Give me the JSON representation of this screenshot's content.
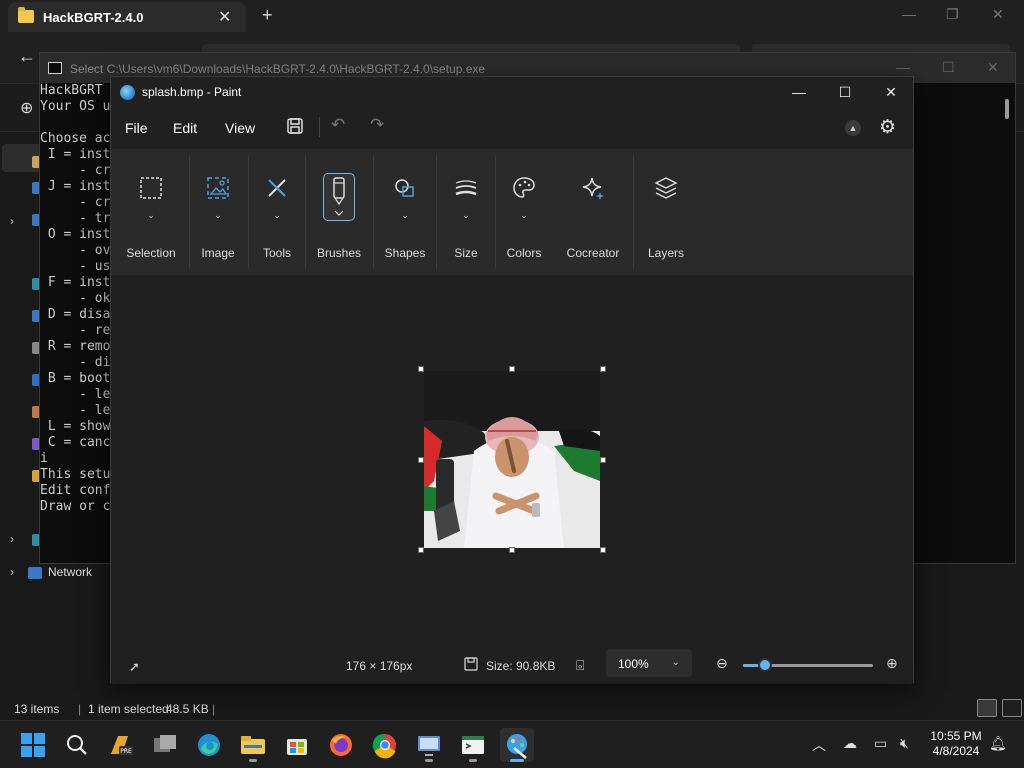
{
  "explorer": {
    "tab_title": "HackBGRT-2.4.0",
    "sidebar_network": "Network",
    "status": {
      "items_count": "13 items",
      "selection": "1 item selected",
      "size": "48.5 KB"
    }
  },
  "console": {
    "title": "Select C:\\Users\\vm6\\Downloads\\HackBGRT-2.4.0\\HackBGRT-2.4.0\\setup.exe",
    "lines": [
      "HackBGRT",
      "Your OS u",
      "",
      "Choose ac",
      " I = inst",
      "     - cr",
      " J = inst",
      "     - cr",
      "     - tr",
      " O = inst",
      "     - ov",
      "     - us",
      " F = inst",
      "     - ok",
      " D = disa",
      "     - re",
      " R = remo",
      "     - di",
      " B = boot",
      "     - le",
      "     - le",
      " L = show",
      " C = canc",
      "i",
      "This setu",
      "Edit conf",
      "Draw or c"
    ]
  },
  "paint": {
    "title": "splash.bmp - Paint",
    "menu": {
      "file": "File",
      "edit": "Edit",
      "view": "View"
    },
    "tools": {
      "selection": "Selection",
      "image": "Image",
      "tools": "Tools",
      "brushes": "Brushes",
      "shapes": "Shapes",
      "size": "Size",
      "colors": "Colors",
      "cocreator": "Cocreator",
      "layers": "Layers"
    },
    "status": {
      "dimensions": "176 × 176px",
      "size": "Size: 90.8KB",
      "zoom": "100%",
      "zoom_fraction": 0.17
    },
    "accent_color": "#60b3ec"
  },
  "taskbar": {
    "apps": [
      "start-icon",
      "search-icon",
      "file-manager-pre-icon",
      "task-view-icon",
      "edge-icon",
      "file-explorer-icon",
      "store-icon",
      "firefox-icon",
      "chrome-icon",
      "remote-desktop-icon",
      "console-window-icon",
      "paint-icon"
    ],
    "time": "10:55 PM",
    "date": "4/8/2024"
  }
}
